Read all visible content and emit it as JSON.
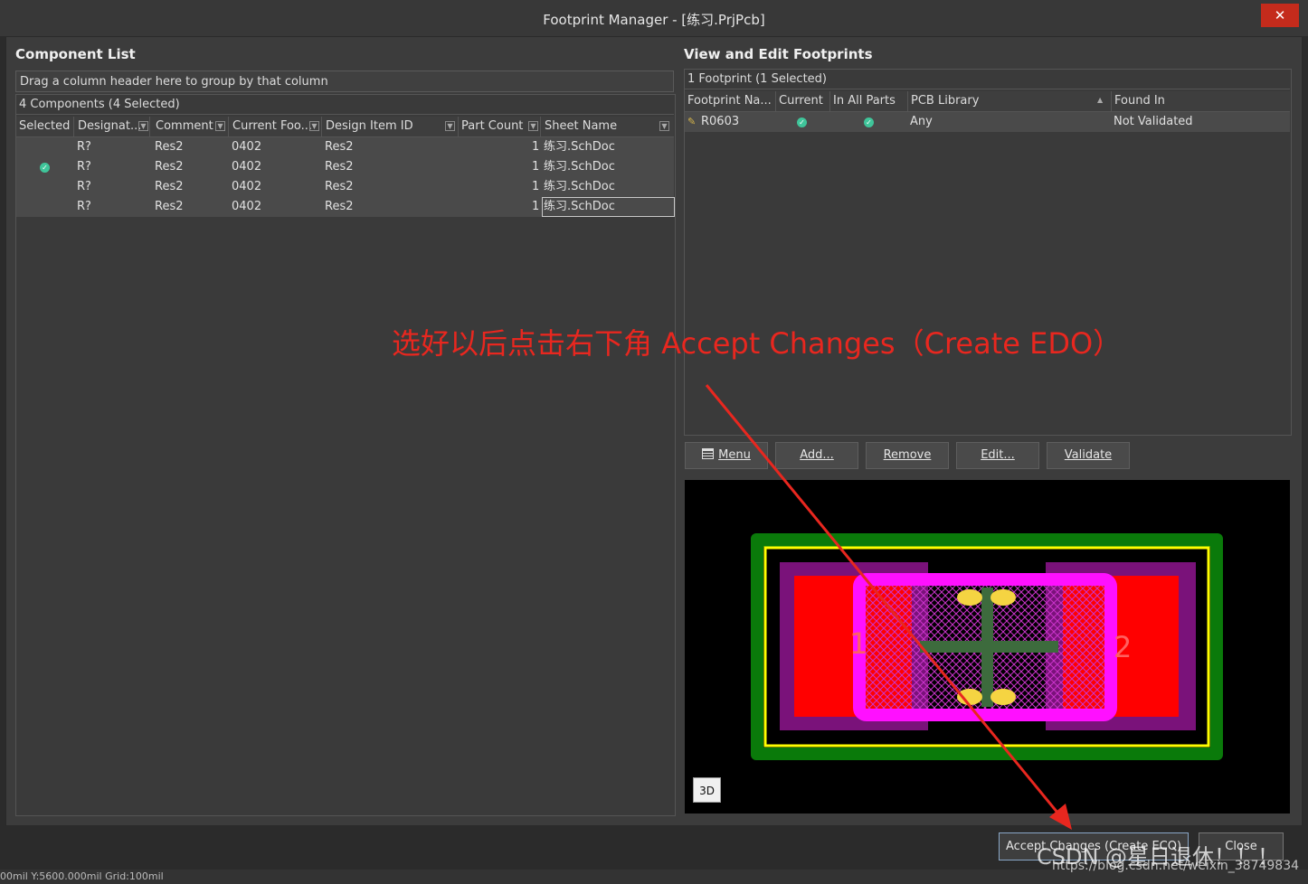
{
  "window": {
    "title": "Footprint Manager - [练习.PrjPcb]",
    "close_glyph": "✕"
  },
  "component_list": {
    "heading": "Component List",
    "group_hint": "Drag a column header here to group by that column",
    "count_label": "4 Components (4 Selected)",
    "columns": [
      "Selected",
      "Designat...",
      "Comment",
      "Current Foo...",
      "Design Item ID",
      "Part Count",
      "Sheet Name"
    ],
    "rows": [
      {
        "selected": "",
        "designator": "R?",
        "comment": "Res2",
        "footprint": "0402",
        "design_item": "Res2",
        "part_count": "1",
        "sheet": "练习.SchDoc"
      },
      {
        "selected": "✓",
        "designator": "R?",
        "comment": "Res2",
        "footprint": "0402",
        "design_item": "Res2",
        "part_count": "1",
        "sheet": "练习.SchDoc"
      },
      {
        "selected": "",
        "designator": "R?",
        "comment": "Res2",
        "footprint": "0402",
        "design_item": "Res2",
        "part_count": "1",
        "sheet": "练习.SchDoc"
      },
      {
        "selected": "",
        "designator": "R?",
        "comment": "Res2",
        "footprint": "0402",
        "design_item": "Res2",
        "part_count": "1",
        "sheet": "练习.SchDoc"
      }
    ]
  },
  "footprints": {
    "heading": "View and Edit Footprints",
    "count_label": "1 Footprint (1 Selected)",
    "columns": [
      "Footprint Na...",
      "Current",
      "In All Parts",
      "PCB Library",
      "Found In"
    ],
    "rows": [
      {
        "name": "R0603",
        "current": "✓",
        "in_all_parts": "✓",
        "library": "Any",
        "found_in": "Not Validated"
      }
    ],
    "buttons": {
      "menu": "Menu",
      "add": "Add...",
      "remove": "Remove",
      "edit": "Edit...",
      "validate": "Validate"
    },
    "preview_3d": "3D",
    "pad_left": "1",
    "pad_right": "2"
  },
  "annotation": {
    "text": "选好以后点击右下角 Accept Changes（Create EDO）",
    "color": "#e8271f"
  },
  "footer": {
    "accept_label": "Accept Changes (Create ECO)",
    "close_label": "Close",
    "watermark": "CSDN @星日退休！！！",
    "url": "https://blog.csdn.net/weixin_38749834"
  },
  "status_bar": {
    "text": "00mil Y:5600.000mil    Grid:100mil"
  }
}
